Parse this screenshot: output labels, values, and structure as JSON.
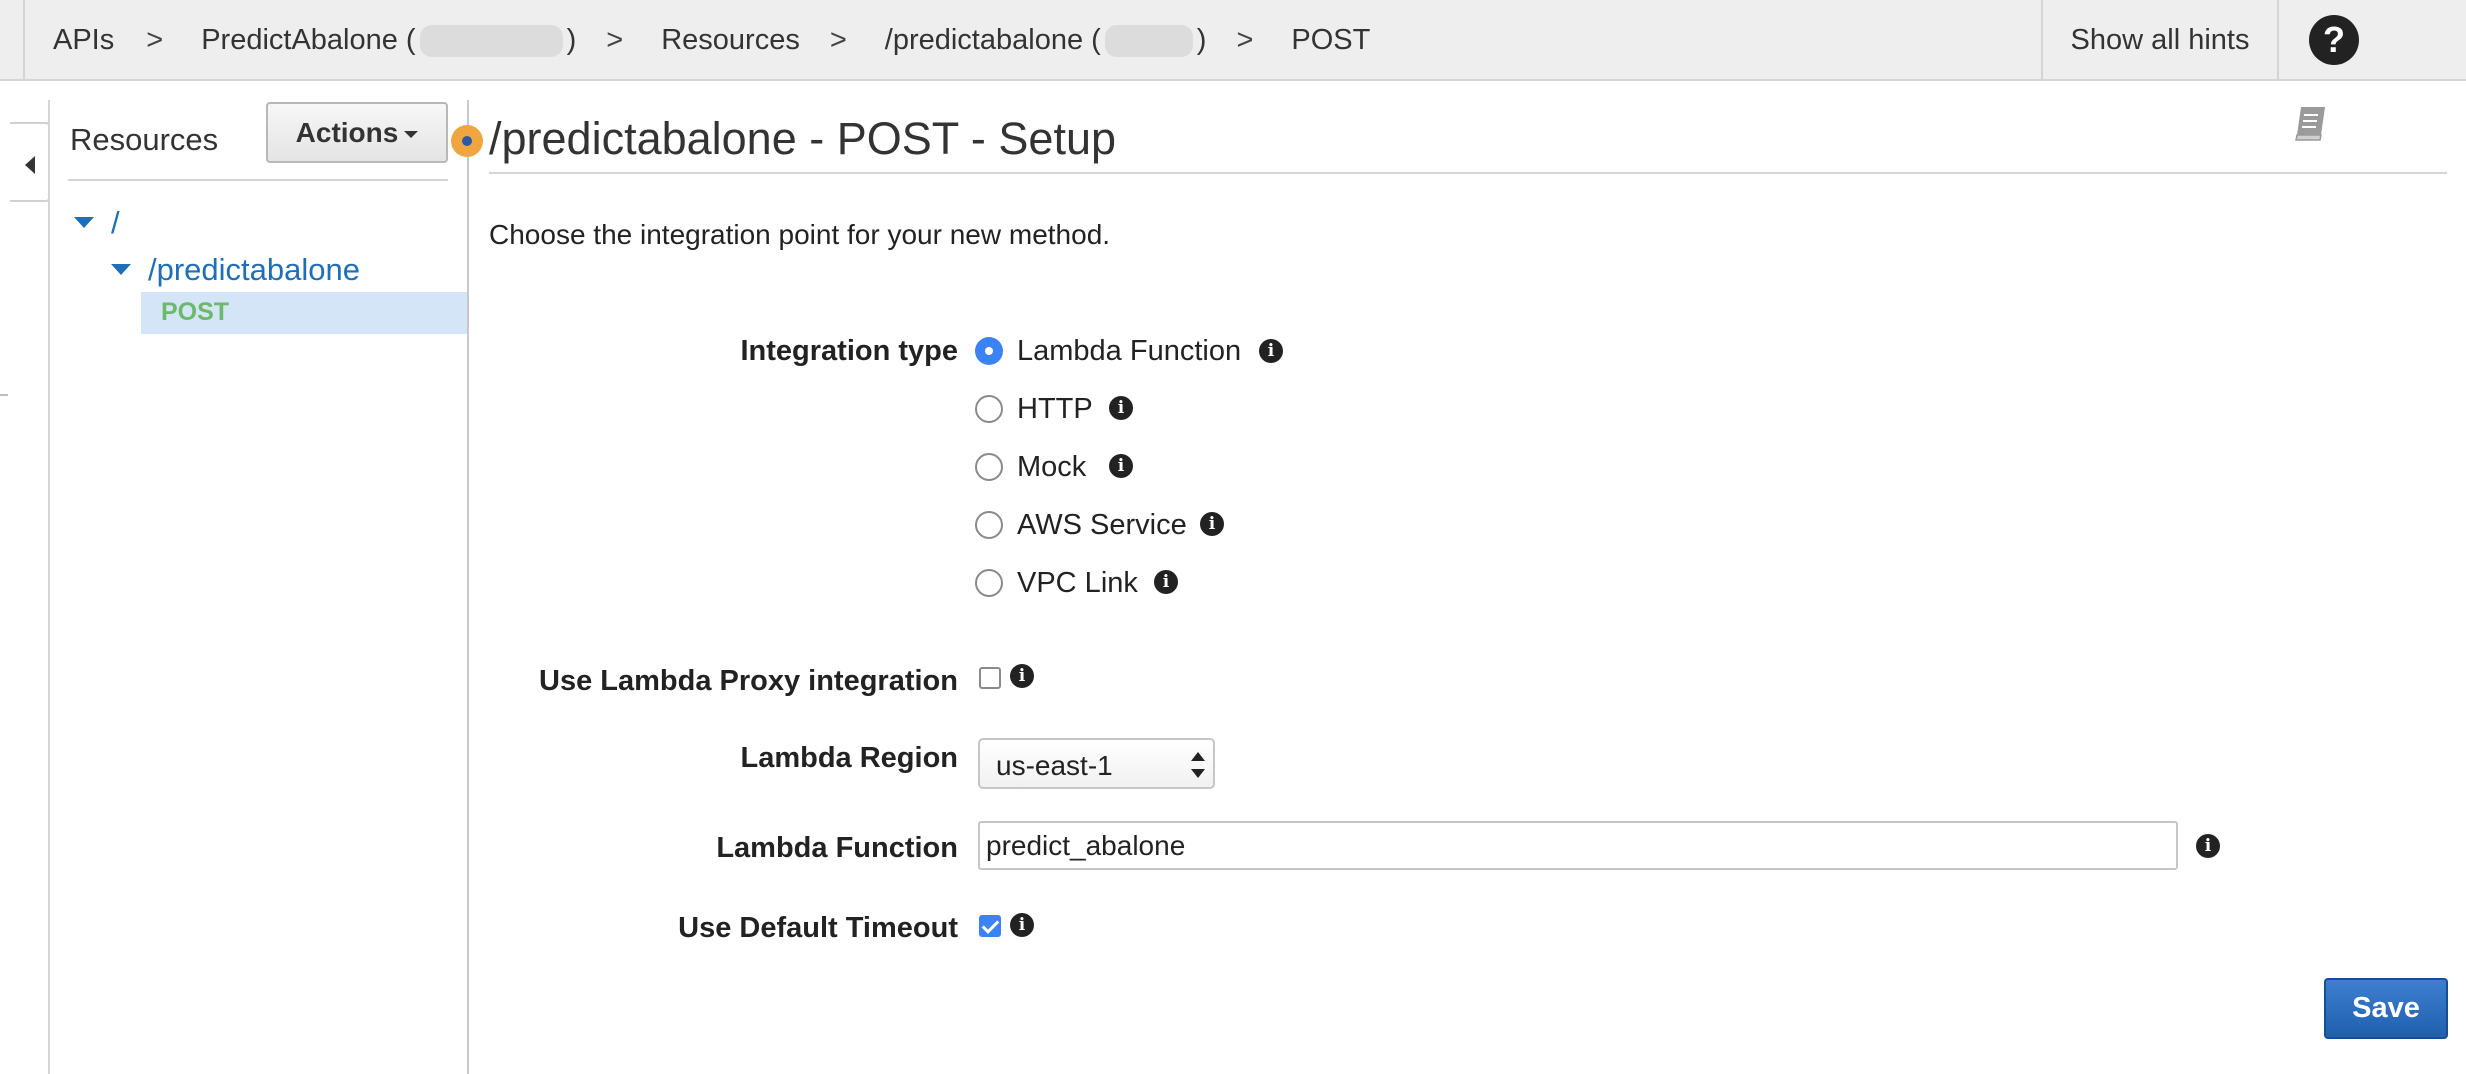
{
  "breadcrumb": {
    "apis": "APIs",
    "separator": ">",
    "api_name_open": "PredictAbalone (",
    "api_name_close": ")",
    "resources": "Resources",
    "resource_open": "/predictabalone (",
    "resource_close": ")",
    "method": "POST"
  },
  "header": {
    "show_hints": "Show all hints",
    "help_glyph": "?"
  },
  "sidebar": {
    "title": "Resources",
    "actions_label": "Actions",
    "tree": {
      "root": "/",
      "resource": "/predictabalone",
      "method": "POST"
    }
  },
  "main": {
    "title": "/predictabalone - POST - Setup",
    "intro": "Choose the integration point for your new method.",
    "integration_type": {
      "label": "Integration type",
      "options": [
        {
          "label": "Lambda Function",
          "selected": true
        },
        {
          "label": "HTTP",
          "selected": false
        },
        {
          "label": "Mock",
          "selected": false
        },
        {
          "label": "AWS Service",
          "selected": false
        },
        {
          "label": "VPC Link",
          "selected": false
        }
      ]
    },
    "proxy": {
      "label": "Use Lambda Proxy integration",
      "checked": false
    },
    "region": {
      "label": "Lambda Region",
      "value": "us-east-1"
    },
    "function": {
      "label": "Lambda Function",
      "value": "predict_abalone"
    },
    "timeout": {
      "label": "Use Default Timeout",
      "checked": true
    },
    "save_label": "Save",
    "info_glyph": "i"
  },
  "colors": {
    "accent_blue": "#3b82f6",
    "link_blue": "#1f6fb8",
    "method_green": "#6cb86c",
    "save_blue": "#2f6fbf",
    "hint_orange": "#f0a640"
  },
  "icons": [
    "collapse-panel-icon",
    "help-icon",
    "book-icon",
    "info-icon",
    "tree-caret-icon",
    "hint-dot-icon"
  ]
}
